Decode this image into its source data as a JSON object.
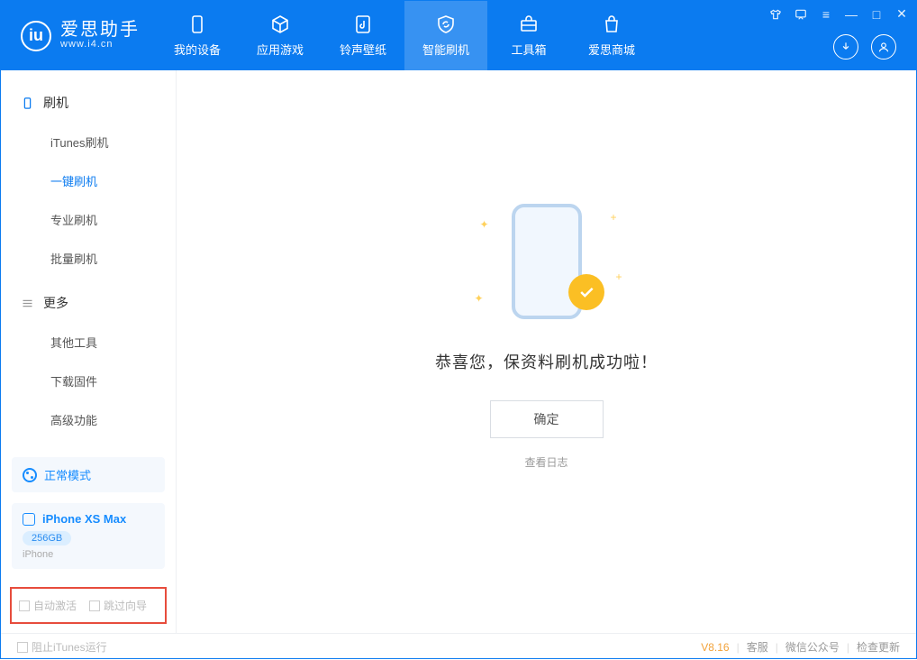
{
  "app": {
    "name": "爱思助手",
    "website": "www.i4.cn"
  },
  "nav": {
    "tabs": [
      {
        "id": "device",
        "label": "我的设备"
      },
      {
        "id": "apps",
        "label": "应用游戏"
      },
      {
        "id": "rings",
        "label": "铃声壁纸"
      },
      {
        "id": "flash",
        "label": "智能刷机"
      },
      {
        "id": "tools",
        "label": "工具箱"
      },
      {
        "id": "store",
        "label": "爱思商城"
      }
    ],
    "active": "flash"
  },
  "sidebar": {
    "sections": [
      {
        "title": "刷机",
        "items": [
          {
            "label": "iTunes刷机"
          },
          {
            "label": "一键刷机",
            "active": true
          },
          {
            "label": "专业刷机"
          },
          {
            "label": "批量刷机"
          }
        ]
      },
      {
        "title": "更多",
        "items": [
          {
            "label": "其他工具"
          },
          {
            "label": "下载固件"
          },
          {
            "label": "高级功能"
          }
        ]
      }
    ],
    "mode": {
      "label": "正常模式"
    },
    "device": {
      "name": "iPhone XS Max",
      "storage": "256GB",
      "type": "iPhone"
    },
    "options": {
      "auto_activate": "自动激活",
      "skip_guide": "跳过向导"
    }
  },
  "main": {
    "success_text": "恭喜您，保资料刷机成功啦！",
    "ok_button": "确定",
    "view_log": "查看日志"
  },
  "footer": {
    "block_itunes": "阻止iTunes运行",
    "version": "V8.16",
    "links": {
      "support": "客服",
      "wechat": "微信公众号",
      "update": "检查更新"
    }
  }
}
